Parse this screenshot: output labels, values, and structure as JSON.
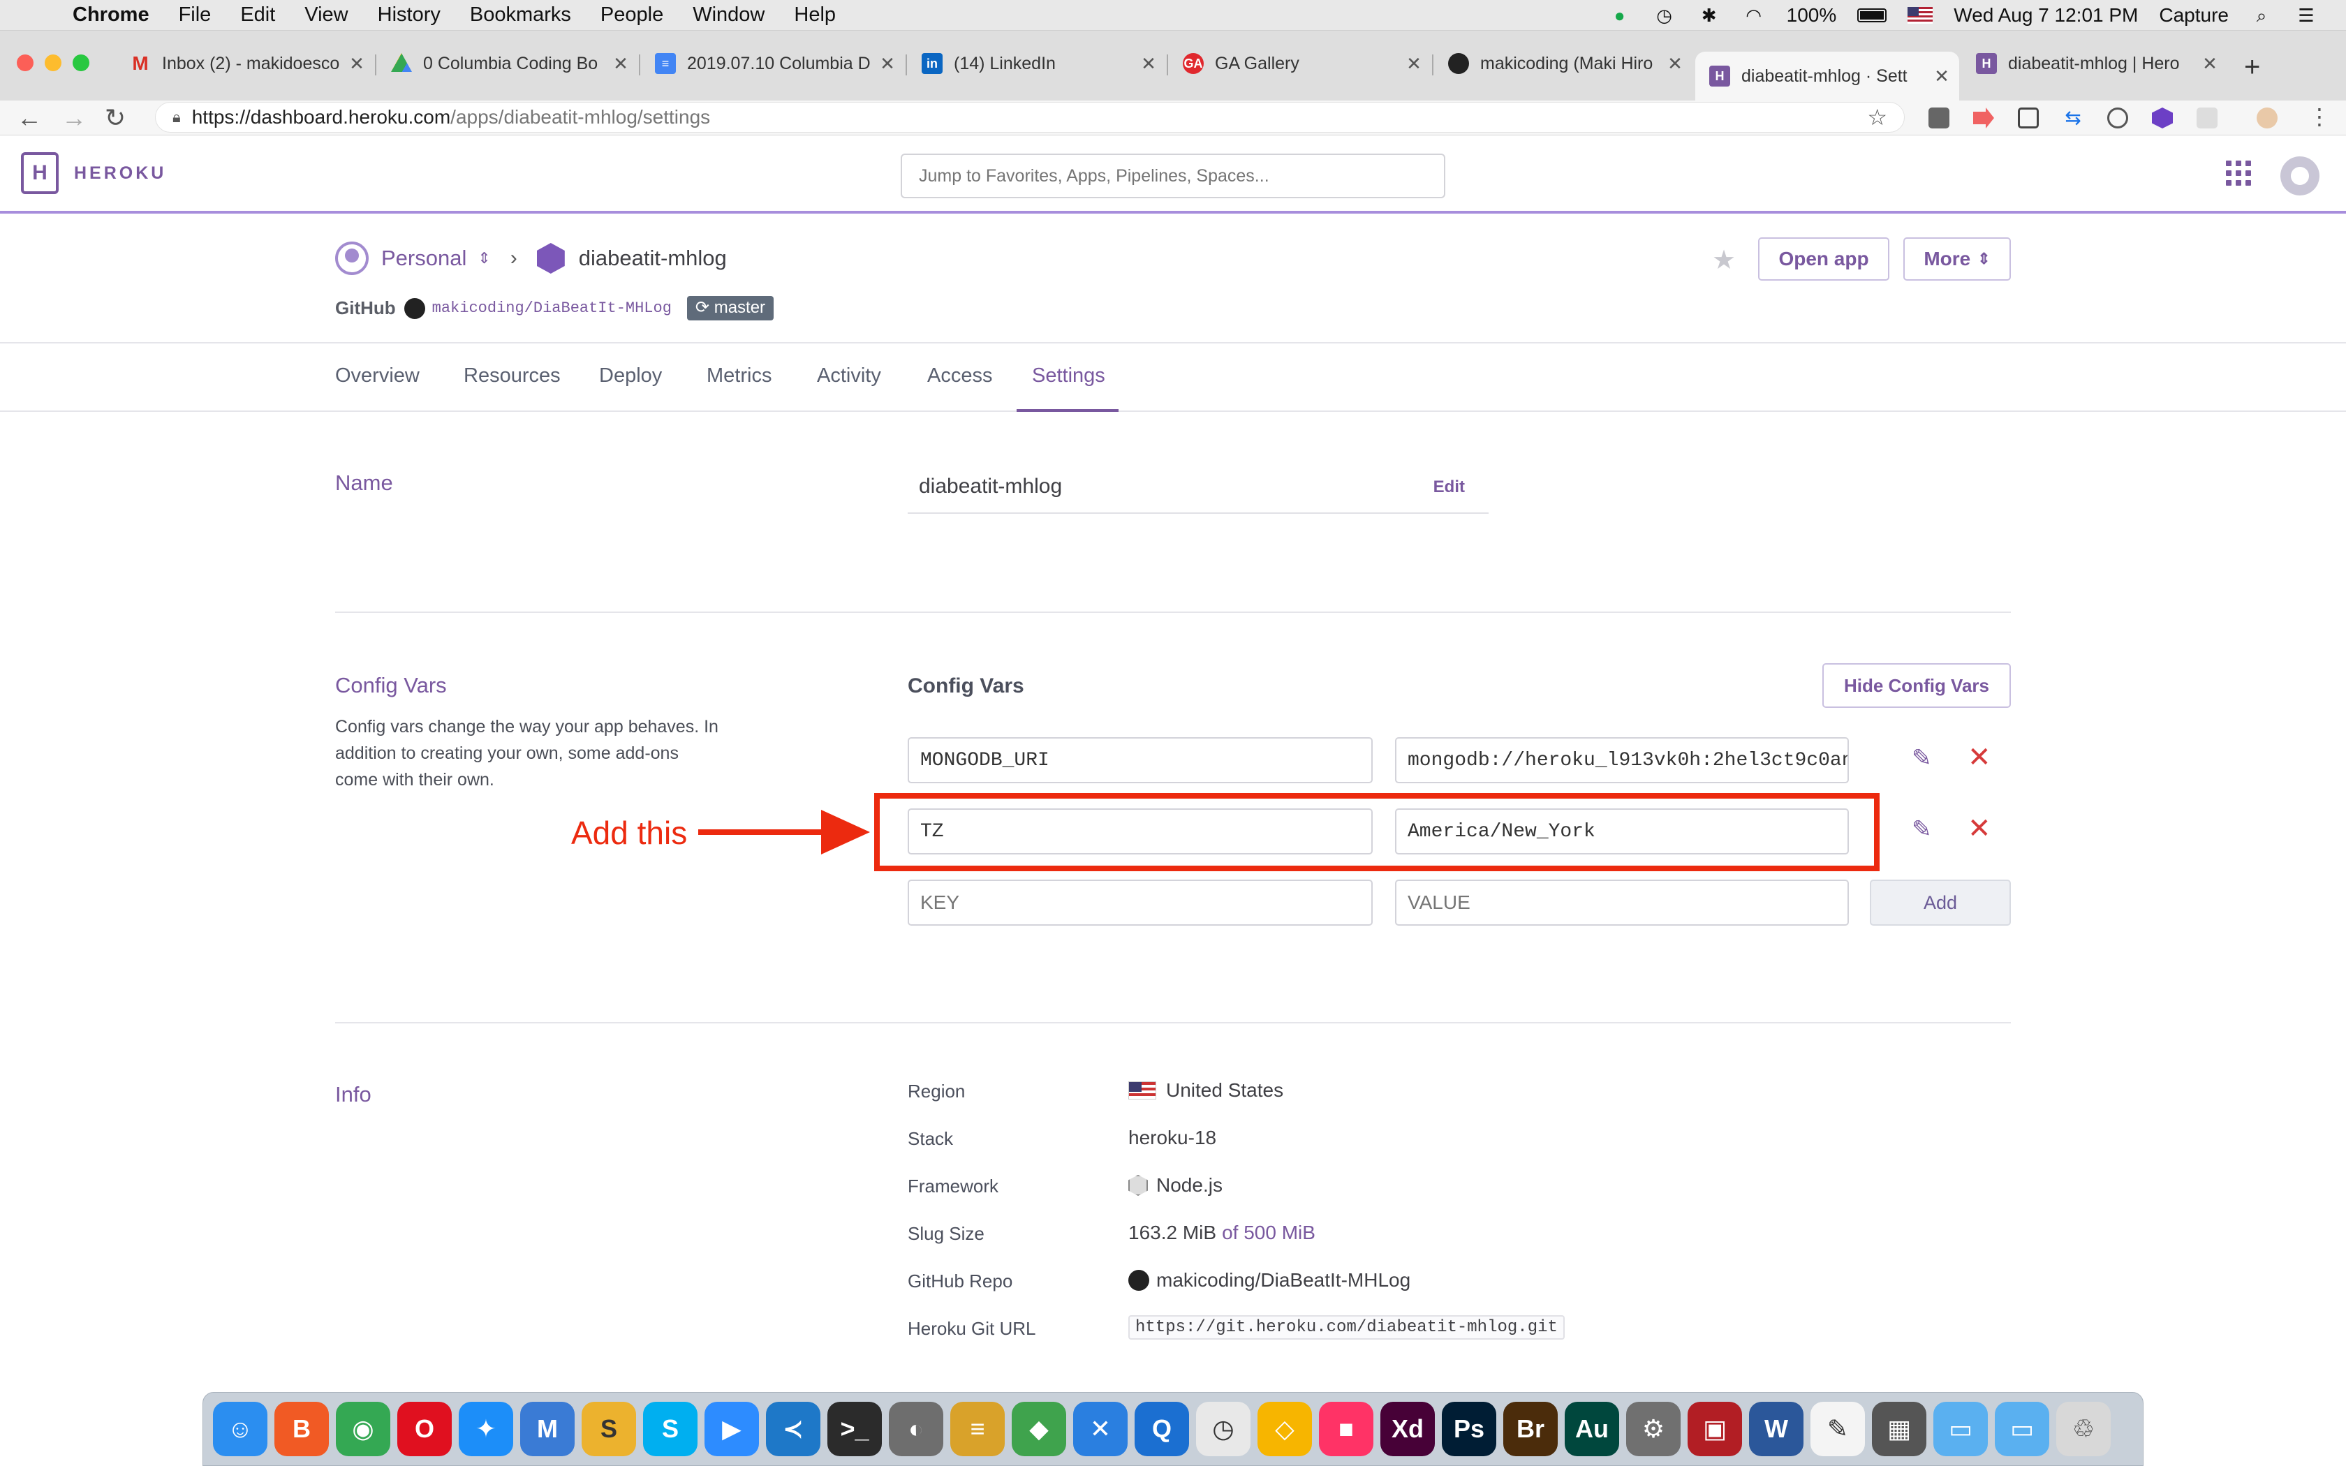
{
  "menubar": {
    "app": "Chrome",
    "items": [
      "File",
      "Edit",
      "View",
      "History",
      "Bookmarks",
      "People",
      "Window",
      "Help"
    ],
    "battery": "100%",
    "datetime": "Wed Aug 7  12:01 PM",
    "capture": "Capture"
  },
  "tabs": [
    {
      "title": "Inbox (2) - makidoesco",
      "icon": "gmail-icon",
      "color": "#d93025"
    },
    {
      "title": "0 Columbia Coding Bo",
      "icon": "google-drive-icon",
      "color": "#1a73e8"
    },
    {
      "title": "2019.07.10 Columbia D",
      "icon": "google-docs-icon",
      "color": "#4285f4"
    },
    {
      "title": "(14) LinkedIn",
      "icon": "linkedin-icon",
      "color": "#0a66c2"
    },
    {
      "title": "GA Gallery",
      "icon": "ga-icon",
      "color": "#e0282e"
    },
    {
      "title": "makicoding (Maki Hiro",
      "icon": "github-icon",
      "color": "#222222"
    },
    {
      "title": "diabeatit-mhlog · Sett",
      "icon": "heroku-icon",
      "color": "#79589f"
    },
    {
      "title": "diabeatit-mhlog | Hero",
      "icon": "heroku-icon",
      "color": "#79589f"
    }
  ],
  "address": {
    "host": "https://dashboard.heroku.com",
    "path": "/apps/diabeatit-mhlog/settings"
  },
  "heroku": {
    "wordmark": "HEROKU",
    "search_placeholder": "Jump to Favorites, Apps, Pipelines, Spaces..."
  },
  "app": {
    "owner": "Personal",
    "name": "diabeatit-mhlog",
    "github_label": "GitHub",
    "repo": "makicoding/DiaBeatIt-MHLog",
    "branch": "master",
    "open_app": "Open app",
    "more": "More"
  },
  "nav": [
    "Overview",
    "Resources",
    "Deploy",
    "Metrics",
    "Activity",
    "Access",
    "Settings"
  ],
  "name_section": {
    "title": "Name",
    "value": "diabeatit-mhlog",
    "edit": "Edit"
  },
  "config": {
    "title": "Config Vars",
    "description": "Config vars change the way your app behaves. In addition to creating your own, some add-ons come with their own.",
    "heading": "Config Vars",
    "hide_button": "Hide Config Vars",
    "vars": [
      {
        "key": "MONGODB_URI",
        "value": "mongodb://heroku_l913vk0h:2hel3ct9c0an"
      },
      {
        "key": "TZ",
        "value": "America/New_York"
      }
    ],
    "key_placeholder": "KEY",
    "value_placeholder": "VALUE",
    "add_button": "Add"
  },
  "annotation": {
    "text": "Add this",
    "color": "#ec2a0f"
  },
  "info": {
    "title": "Info",
    "rows": [
      {
        "label": "Region",
        "value": "United States"
      },
      {
        "label": "Stack",
        "value": "heroku-18"
      },
      {
        "label": "Framework",
        "value": "Node.js"
      },
      {
        "label": "Slug Size",
        "value": "163.2 MiB",
        "extra": "of 500 MiB"
      },
      {
        "label": "GitHub Repo",
        "value": "makicoding/DiaBeatIt-MHLog"
      },
      {
        "label": "Heroku Git URL",
        "value": "https://git.heroku.com/diabeatit-mhlog.git"
      }
    ]
  },
  "dock": [
    {
      "name": "finder-icon",
      "color": "#2b8ef0",
      "glyph": "☺"
    },
    {
      "name": "brave-icon",
      "color": "#f15a24",
      "glyph": "B"
    },
    {
      "name": "chrome-icon",
      "color": "#34a853",
      "glyph": "◉"
    },
    {
      "name": "opera-icon",
      "color": "#e0101f",
      "glyph": "O"
    },
    {
      "name": "safari-icon",
      "color": "#1c8ef9",
      "glyph": "✦"
    },
    {
      "name": "markdown-icon",
      "color": "#3a7bd5",
      "glyph": "M"
    },
    {
      "name": "slack-icon",
      "color": "#ecb22e",
      "glyph": "S"
    },
    {
      "name": "skype-icon",
      "color": "#00aff0",
      "glyph": "S"
    },
    {
      "name": "zoom-icon",
      "color": "#2d8cff",
      "glyph": "▶"
    },
    {
      "name": "vscode-icon",
      "color": "#1e78c8",
      "glyph": "≺"
    },
    {
      "name": "terminal-icon",
      "color": "#2b2b2b",
      "glyph": ">_"
    },
    {
      "name": "tableplus-icon",
      "color": "#6e6e6e",
      "glyph": "◐"
    },
    {
      "name": "sequel-icon",
      "color": "#d9a22a",
      "glyph": "≡"
    },
    {
      "name": "robo3t-icon",
      "color": "#3fa34d",
      "glyph": "◆"
    },
    {
      "name": "xcode-icon",
      "color": "#2a7fe0",
      "glyph": "✕"
    },
    {
      "name": "quicktime-icon",
      "color": "#1b6fd1",
      "glyph": "Q"
    },
    {
      "name": "clock-icon",
      "color": "#e8e8e8",
      "glyph": "◷"
    },
    {
      "name": "sketch-icon",
      "color": "#f7b500",
      "glyph": "◇"
    },
    {
      "name": "invision-icon",
      "color": "#ff3366",
      "glyph": "■"
    },
    {
      "name": "xd-icon",
      "color": "#470137",
      "glyph": "Xd"
    },
    {
      "name": "photoshop-icon",
      "color": "#001d34",
      "glyph": "Ps"
    },
    {
      "name": "bridge-icon",
      "color": "#4b2c0b",
      "glyph": "Br"
    },
    {
      "name": "audition-icon",
      "color": "#00473d",
      "glyph": "Au"
    },
    {
      "name": "settings-icon",
      "color": "#707070",
      "glyph": "⚙"
    },
    {
      "name": "photobooth-icon",
      "color": "#b21e24",
      "glyph": "▣"
    },
    {
      "name": "word-icon",
      "color": "#2b579a",
      "glyph": "W"
    },
    {
      "name": "textedit-icon",
      "color": "#f4f4f4",
      "glyph": "✎"
    },
    {
      "name": "calculator-icon",
      "color": "#555555",
      "glyph": "▦"
    },
    {
      "name": "folder-icon",
      "color": "#5ab0f0",
      "glyph": "▭"
    },
    {
      "name": "downloads-icon",
      "color": "#5ab0f0",
      "glyph": "▭"
    },
    {
      "name": "trash-icon",
      "color": "#d8d8d8",
      "glyph": "♲"
    }
  ]
}
